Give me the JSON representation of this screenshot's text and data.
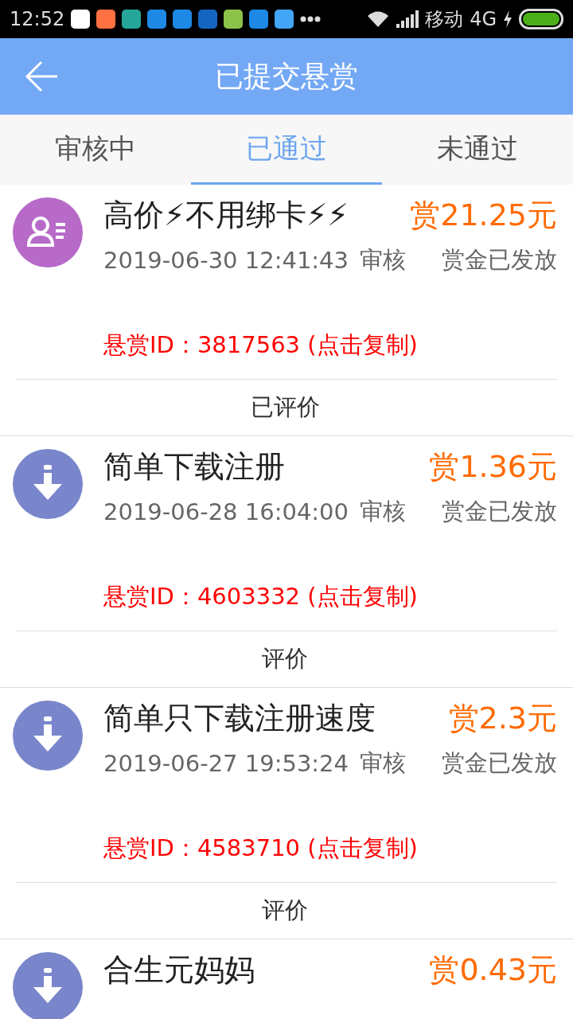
{
  "status_bar": {
    "time": "12:52",
    "carrier": "移动",
    "network": "4G"
  },
  "header": {
    "title": "已提交悬赏"
  },
  "tabs": [
    {
      "label": "审核中",
      "selected": false
    },
    {
      "label": "已通过",
      "selected": true
    },
    {
      "label": "未通过",
      "selected": false
    }
  ],
  "tasks": [
    {
      "kind": "profile",
      "title": "高价⚡不用绑卡⚡⚡",
      "reward": "赏21.25元",
      "time": "2019-06-30 12:41:43",
      "stage": "审核",
      "payout": "赏金已发放",
      "reward_id": "悬赏ID：3817563 (点击复制)",
      "review": "已评价"
    },
    {
      "kind": "download",
      "title": "简单下载注册",
      "reward": "赏1.36元",
      "time": "2019-06-28 16:04:00",
      "stage": "审核",
      "payout": "赏金已发放",
      "reward_id": "悬赏ID：4603332 (点击复制)",
      "review": "评价"
    },
    {
      "kind": "download",
      "title": "简单只下载注册速度",
      "reward": "赏2.3元",
      "time": "2019-06-27 19:53:24",
      "stage": "审核",
      "payout": "赏金已发放",
      "reward_id": "悬赏ID：4583710 (点击复制)",
      "review": "评价"
    },
    {
      "kind": "download",
      "title": "合生元妈妈",
      "reward": "赏0.43元"
    }
  ]
}
